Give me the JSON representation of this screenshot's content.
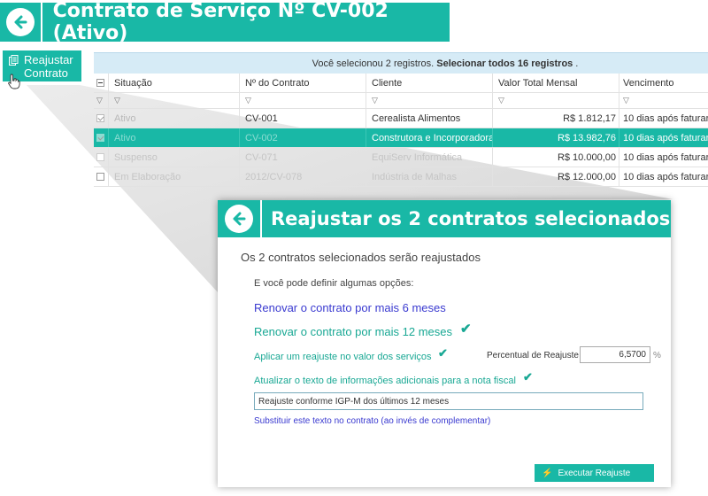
{
  "header": {
    "title": "Contrato de Serviço Nº CV-002 (Ativo)"
  },
  "sidebar_button": {
    "label_line1": "Reajustar",
    "label_line2": "Contrato"
  },
  "grid": {
    "selection_info": "Você selecionou 2 registros.",
    "select_all_link": "Selecionar todos 16 registros",
    "select_all_suffix": ".",
    "columns": [
      "Situação",
      "Nº do Contrato",
      "Cliente",
      "Valor Total Mensal",
      "Vencimento"
    ],
    "rows": [
      {
        "situacao": "Ativo",
        "contrato": "CV-001",
        "cliente": "Cerealista Alimentos",
        "valor": "R$ 1.812,17",
        "vencimento": "10 dias após faturar"
      },
      {
        "situacao": "Ativo",
        "contrato": "CV-002",
        "cliente": "Construtora e Incorporadora",
        "valor": "R$ 13.982,76",
        "vencimento": "10 dias após faturar"
      },
      {
        "situacao": "Suspenso",
        "contrato": "CV-071",
        "cliente": "EquiServ Informática",
        "valor": "R$ 10.000,00",
        "vencimento": "10 dias após faturar"
      },
      {
        "situacao": "Em Elaboração",
        "contrato": "2012/CV-078",
        "cliente": "Indústria de Malhas",
        "valor": "R$ 12.000,00",
        "vencimento": "10 dias após faturar"
      }
    ]
  },
  "dialog": {
    "title": "Reajustar os 2 contratos selecionados",
    "subtitle": "Os 2 contratos selecionados serão reajustados",
    "options_intro": "E você pode definir algumas opções:",
    "renew_6": "Renovar o contrato por mais 6 meses",
    "renew_12": "Renovar o contrato por mais 12 meses",
    "apply_adjust": "Aplicar um reajuste no valor dos serviços",
    "pct_label": "Percentual de Reajuste",
    "pct_value": "6,5700",
    "pct_unit": "%",
    "update_text": "Atualizar o texto de informações adicionais para a nota fiscal",
    "text_value": "Reajuste conforme IGP-M dos últimos 12 meses",
    "replace_link": "Substituir este texto no contrato (ao invés de complementar)",
    "exec_button": "Executar Reajuste"
  },
  "colors": {
    "accent": "#19b8a6",
    "link_blue": "#3a3ad0",
    "link_teal": "#19a894",
    "info_bar": "#d6ebf6"
  },
  "icons": [
    "back-arrow-icon",
    "document-icon",
    "hand-pointer-icon",
    "checkbox-icon",
    "filter-icon",
    "checkmark-icon",
    "bolt-icon"
  ]
}
